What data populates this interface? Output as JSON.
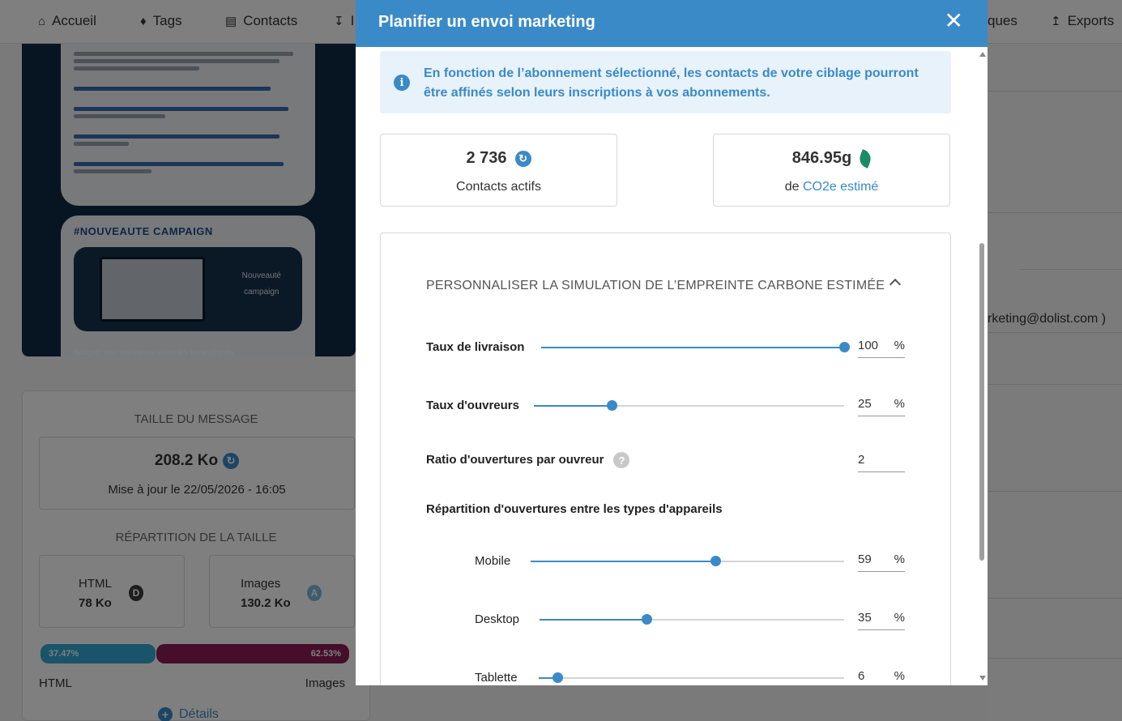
{
  "nav": {
    "items": [
      {
        "label": "Accueil",
        "icon": "home-icon"
      },
      {
        "label": "Tags",
        "icon": "tag-icon"
      },
      {
        "label": "Contacts",
        "icon": "address-book-icon"
      },
      {
        "label": "I",
        "icon": "download-icon"
      },
      {
        "label": "ques",
        "icon": ""
      },
      {
        "label": "Exports",
        "icon": "upload-icon"
      }
    ]
  },
  "preview": {
    "hashtag": "#NOUVEAUTE CAMPAIGN",
    "badge_line1": "Nouveauté",
    "badge_line2": "campaign",
    "footer_text": "Adapter vos scénarios selon les liens cliqués"
  },
  "size_panel": {
    "title": "TAILLE DU MESSAGE",
    "size_value": "208.2 Ko",
    "updated": "Mise à jour le 22/05/2026 - 16:05",
    "breakdown_title": "RÉPARTITION DE LA TAILLE",
    "html_label": "HTML",
    "html_value": "78 Ko",
    "html_grade": "D",
    "images_label": "Images",
    "images_value": "130.2 Ko",
    "images_grade": "A",
    "html_percent": "37.47%",
    "images_percent": "62.53%",
    "legend_html": "HTML",
    "legend_images": "Images",
    "details_label": "Détails",
    "colors": {
      "html_bar": "#35a8d4",
      "images_bar": "#8c1c55"
    }
  },
  "right_pane": {
    "email_fragment": "rketing@dolist.com )"
  },
  "modal": {
    "title": "Planifier un envoi marketing",
    "close_icon": "close-icon",
    "info_text": "En fonction de l’abonnement sélectionné, les contacts de votre ciblage pourront être affinés selon leurs inscriptions à vos abonnements.",
    "contacts_value": "2 736",
    "contacts_label": "Contacts actifs",
    "co2_value": "846.95g",
    "co2_prefix": "de",
    "co2_link": "CO2e estimé",
    "simulation_title": "PERSONNALISER LA SIMULATION DE L’EMPREINTE CARBONE ESTIMÉE",
    "delivery_label": "Taux de livraison",
    "delivery_value": "100",
    "delivery_unit": "%",
    "delivery_level": 1.0,
    "openers_label": "Taux d'ouvreurs",
    "openers_value": "25",
    "openers_unit": "%",
    "openers_level": 0.25,
    "ratio_label": "Ratio d'ouvertures par ouvreur",
    "ratio_value": "2",
    "devices_title": "Répartition d'ouvertures entre les types d'appareils",
    "mobile_label": "Mobile",
    "mobile_value": "59",
    "mobile_unit": "%",
    "mobile_level": 0.59,
    "desktop_label": "Desktop",
    "desktop_value": "35",
    "desktop_unit": "%",
    "desktop_level": 0.35,
    "tablet_label": "Tablette",
    "tablet_value": "6",
    "tablet_unit": "%",
    "tablet_level": 0.06,
    "accent_color": "#3a8ac7",
    "leaf_color": "#1a8a67"
  }
}
